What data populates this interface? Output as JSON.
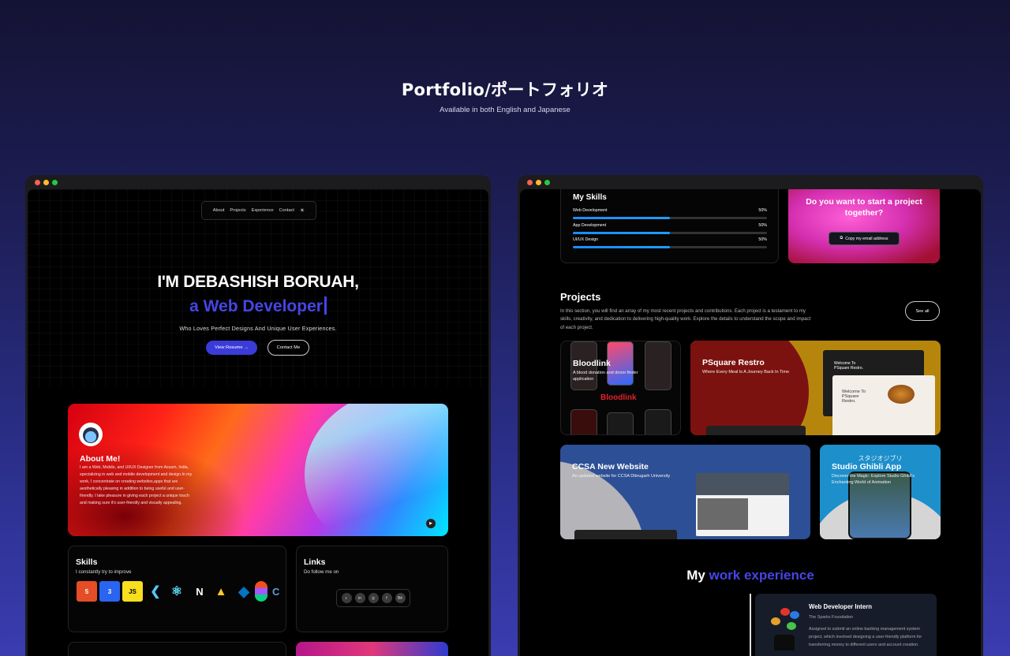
{
  "header": {
    "title": "Portfolio/ポートフォリオ",
    "subtitle": "Available in both English and Japanese"
  },
  "left": {
    "nav": [
      "About",
      "Projects",
      "Experience",
      "Contact"
    ],
    "hero": {
      "line1": "I'M DEBASHISH BORUAH,",
      "line2": "a Web Developer",
      "tagline": "Who Loves Perfect Designs And Unique User Experiences.",
      "resume_btn": "View Resume →",
      "contact_btn": "Contact Me"
    },
    "about": {
      "title": "About Me!",
      "text": "I am a Web, Mobile, and UI/UX Designer from Assam, India, specializing in web and mobile development and design.In my work, I concentrate on creating websites,apps that are aesthetically pleasing in addition to being useful and user-friendly. I take pleasure in giving each project a unique touch and making sure it's user-friendly and visually appealing."
    },
    "skills": {
      "title": "Skills",
      "subtitle": "I constantly try to improve",
      "icons": [
        "html5-icon",
        "css3-icon",
        "javascript-icon",
        "flutter-icon",
        "react-icon",
        "nextjs-icon",
        "firebase-icon",
        "dart-icon",
        "figma-icon",
        "c-icon"
      ],
      "labels": [
        "5",
        "3",
        "JS",
        "",
        "⚛",
        "N",
        "",
        "",
        "",
        ""
      ]
    },
    "links": {
      "title": "Links",
      "subtitle": "Do follow me on",
      "icons": [
        "github-icon",
        "linkedin-icon",
        "instagram-icon",
        "facebook-icon",
        "behance-icon"
      ],
      "labels": [
        "◐",
        "in",
        "◎",
        "f",
        "Bē"
      ]
    }
  },
  "right": {
    "skills": {
      "title": "My Skills",
      "items": [
        {
          "name": "Web Development",
          "pct": "50%",
          "value": 0.5
        },
        {
          "name": "App Development",
          "pct": "50%",
          "value": 0.5
        },
        {
          "name": "UI/UX Design",
          "pct": "50%",
          "value": 0.5
        }
      ]
    },
    "cta": {
      "title": "Do you want to start a project together?",
      "button": "Copy my email address"
    },
    "projects": {
      "title": "Projects",
      "desc": "In this section, you will find an array of my most recent projects and contributions. Each project is a testament to my skills, creativity, and dedication to delivering high-quality work. Explore the details to understand the scope and impact of each project.",
      "see_all": "See all",
      "items": [
        {
          "title": "Bloodlink",
          "subtitle": "A blood donation and donor finder application",
          "logo": "Bloodlink"
        },
        {
          "title": "PSquare Restro",
          "subtitle": "Where Every Meal Is A Journey Back In Time",
          "mock1": "Welcome To PSquare Restro.",
          "mock2": "Welcome To PSquare Restro."
        },
        {
          "title": "CCSA New Website",
          "subtitle": "An updated website for CCSA Dibrugarh University"
        },
        {
          "title": "Studio Ghibli App",
          "subtitle": "Discover the Magic: Explore Studio Ghibli's Enchanting World of Animation",
          "jp": "スタジオジブリ"
        }
      ]
    },
    "experience": {
      "title_a": "My ",
      "title_b": "work experience",
      "role": "Web Developer Intern",
      "company": "The Sparks Foundation",
      "desc": "Assigned to submit an online banking management system project, which involved designing a user-friendly platform for transferring money to different users and account creation."
    }
  },
  "colors": {
    "accent": "#4545e6",
    "bg_top": "#141334",
    "bg_bottom": "#3a3cb0"
  }
}
